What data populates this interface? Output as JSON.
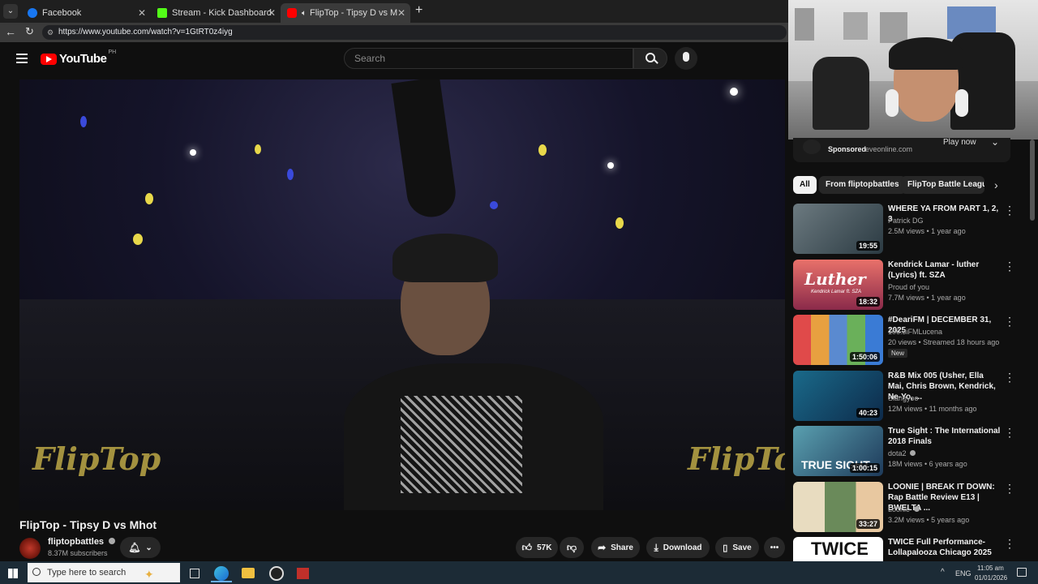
{
  "browser": {
    "tabs": [
      {
        "label": "Facebook",
        "color": "#1877f2"
      },
      {
        "label": "Stream - Kick Dashboard",
        "color": "#53fc18"
      },
      {
        "label": "FlipTop - Tipsy D vs Mhot - Yo",
        "color": "#ff0000"
      }
    ],
    "url": "https://www.youtube.com/watch?v=1GtRT0z4iyg"
  },
  "youtube": {
    "logo_text": "YouTube",
    "region": "PH",
    "search_placeholder": "Search"
  },
  "video": {
    "watermark": "FlipTop",
    "title": "FlipTop - Tipsy D vs Mhot",
    "channel": "fliptopbattles",
    "subscribers": "8.37M subscribers",
    "likes": "57K",
    "share_label": "Share",
    "download_label": "Download",
    "save_label": "Save"
  },
  "ad": {
    "sponsored": "Sponsored",
    "domain": "eveonline.com",
    "cta": "Play now"
  },
  "chips": [
    "All",
    "From fliptopbattles",
    "FlipTop Battle Leagu"
  ],
  "recs": [
    {
      "title": "WHERE YA FROM PART 1, 2, 3",
      "channel": "Patrick DG",
      "meta": "2.5M views • 1 year ago",
      "duration": "19:55",
      "c1": "#2b3a42",
      "c2": "#6c7a80"
    },
    {
      "title": "Kendrick Lamar - luther (Lyrics) ft. SZA",
      "channel": "Proud of you",
      "meta": "7.7M views • 1 year ago",
      "duration": "18:32",
      "thumb_text": "Luther",
      "thumb_sub": "Kendrick Lamar ft. SZA",
      "c1": "#d9534f",
      "c2": "#3a1f4a"
    },
    {
      "title": "#DeariFM | DECEMBER 31, 2025",
      "channel": "106.3iFMLucena",
      "meta": "20 views • Streamed 18 hours ago",
      "duration": "1:50:06",
      "badge": "New",
      "c1": "#e04a4a",
      "c2": "#3a7bd5"
    },
    {
      "title": "R&B Mix 005 (Usher, Ella Mai, Chris Brown, Kendrick, Ne-Yo, ...",
      "channel": "Slangyoo",
      "meta": "12M views • 11 months ago",
      "duration": "40:23",
      "c1": "#0d2a4a",
      "c2": "#1a6a8a"
    },
    {
      "title": "True Sight : The International 2018 Finals",
      "channel": "dota2",
      "meta": "18M views • 6 years ago",
      "duration": "1:00:15",
      "thumb_text": "TRUE SIGHT",
      "c1": "#1e3a5a",
      "c2": "#5aa0b0"
    },
    {
      "title": "LOONIE | BREAK IT DOWN: Rap Battle Review E13 | BWELTA ...",
      "channel": "Loonie",
      "meta": "3.2M views • 5 years ago",
      "duration": "33:27",
      "c1": "#e8dcc0",
      "c2": "#6a8a5a"
    },
    {
      "title": "TWICE Full Performance- Lollapalooza Chicago 2025",
      "channel": "",
      "meta": "",
      "duration": "",
      "thumb_text": "TWICE",
      "c1": "#ffffff",
      "c2": "#d0d0d0"
    }
  ],
  "taskbar": {
    "search_placeholder": "Type here to search",
    "language": "ENG",
    "time": "11:05 am",
    "date": "01/01/2026"
  }
}
